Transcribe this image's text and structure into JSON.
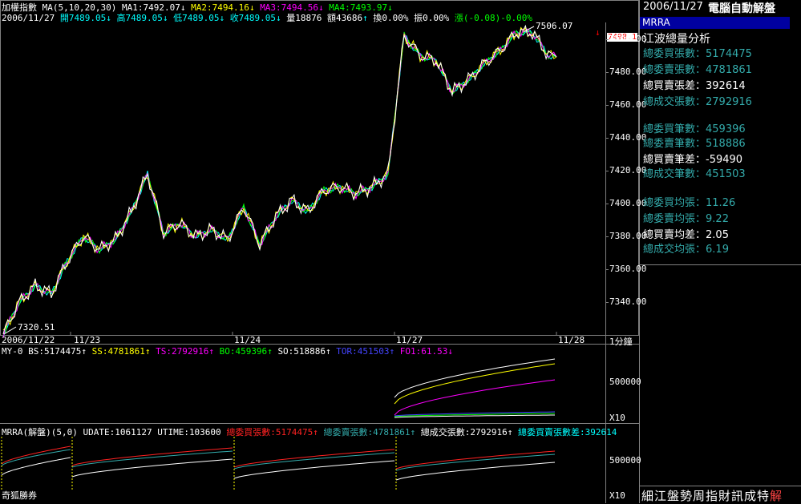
{
  "main_chart": {
    "name": "加權指數",
    "ma_label": "MA(5,10,20,30)",
    "ma1": "MA1:7492.07",
    "ma2": "MA2:7494.16",
    "ma3": "MA3:7494.56",
    "ma4": "MA4:7493.97",
    "info_date": "2006/11/27",
    "open": "開7489.05",
    "high": "高7489.05",
    "low": "低7489.05",
    "close": "收7489.05",
    "vol": "量18876",
    "amount": "額43686",
    "turnover": "換0.00%",
    "swing": "振0.00%",
    "change": "漲(-0.08)-0.00%",
    "hi_label": "7506.07",
    "lo_label": "7320.51",
    "price_tag": "7498.1",
    "colors": {
      "price": "#ffffff",
      "ma1": "#ffff00",
      "ma2": "#ff00ff",
      "ma3": "#00ff00",
      "ma4": "#00ffff"
    }
  },
  "y_axis": [
    "7500.00",
    "7480.00",
    "7460.00",
    "7440.00",
    "7420.00",
    "7400.00",
    "7380.00",
    "7360.00",
    "7340.00"
  ],
  "x_axis": {
    "labels": [
      "2006/11/22",
      "11/23",
      "11/24",
      "11/27",
      "11/28"
    ],
    "unit": "1分鐘"
  },
  "sub1": {
    "name": "MY-0",
    "bs": "BS:5174475",
    "ss": "SS:4781861",
    "ts": "TS:2792916",
    "bo": "BO:459396",
    "so": "SO:518886",
    "tor": "TOR:451503",
    "fo1": "FO1:61.53",
    "axis_label": "500000",
    "scale": "X10"
  },
  "sub2": {
    "name": "MRRA(解盤)(5,0)",
    "udate": "UDATE:1061127",
    "utime": "UTIME:103600",
    "buy": "總委買張數:5174475",
    "sell": "總委賣張數:4781861",
    "deal": "總成交張數:2792916",
    "diff": "總委買賣張數差:392614",
    "axis_label": "500000",
    "scale": "X10"
  },
  "right_panel": {
    "date": "2006/11/27",
    "title": "電腦自動解盤",
    "code": "MRRA",
    "section": "江波總量分析",
    "rows": [
      {
        "label": "總委買張數：",
        "value": "5174475",
        "color": "#33aaaa"
      },
      {
        "label": "總委賣張數：",
        "value": "4781861",
        "color": "#33aaaa"
      },
      {
        "label": "總買賣張差：",
        "value": "392614",
        "color": "#ffffff"
      },
      {
        "label": "總成交張數：",
        "value": "2792916",
        "color": "#33aaaa"
      },
      {
        "label": "總委買筆數：",
        "value": "459396",
        "color": "#33aaaa"
      },
      {
        "label": "總委賣筆數：",
        "value": "518886",
        "color": "#33aaaa"
      },
      {
        "label": "總買賣筆差：",
        "value": "-59490",
        "color": "#ffffff"
      },
      {
        "label": "總成交筆數：",
        "value": "451503",
        "color": "#33aaaa"
      },
      {
        "label": "總委買均張：",
        "value": "11.26",
        "color": "#33aaaa"
      },
      {
        "label": "總委賣均張：",
        "value": "9.22",
        "color": "#33aaaa"
      },
      {
        "label": "總買賣均差：",
        "value": "2.05",
        "color": "#ffffff"
      },
      {
        "label": "總成交均張：",
        "value": "6.19",
        "color": "#33aaaa"
      }
    ],
    "ticker": "細江盤勢周指財訊成特",
    "ticker_tail": "解"
  },
  "footer": {
    "broker": "奇狐勝券"
  },
  "chart_data": {
    "type": "line",
    "title": "加權指數",
    "ylim": [
      7320,
      7510
    ],
    "x": [
      0,
      20,
      40,
      60,
      80,
      100,
      120,
      140,
      160,
      180,
      200,
      220,
      240,
      260,
      280,
      300,
      320,
      340,
      360,
      380,
      400,
      420,
      440,
      460,
      480,
      500,
      520,
      540,
      560,
      580,
      600,
      620,
      640,
      660,
      680,
      690
    ],
    "series": [
      {
        "name": "加權指數",
        "values": [
          7320.51,
          7340,
          7350,
          7345,
          7365,
          7380,
          7372,
          7378,
          7395,
          7418,
          7382,
          7388,
          7380,
          7384,
          7378,
          7398,
          7375,
          7392,
          7402,
          7395,
          7408,
          7410,
          7406,
          7410,
          7418,
          7502,
          7490,
          7487,
          7468,
          7475,
          7485,
          7493,
          7504,
          7504,
          7490,
          7489.05
        ]
      }
    ]
  }
}
